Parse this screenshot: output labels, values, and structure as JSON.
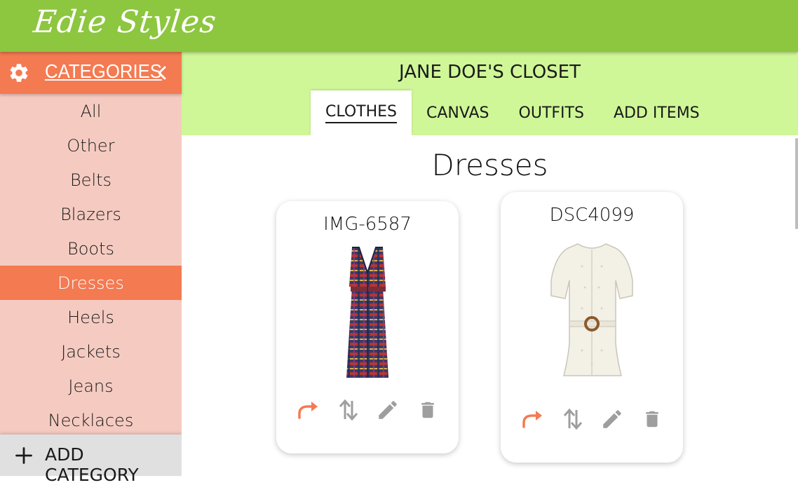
{
  "app": {
    "logo_text": "Edie Styles",
    "brand_color": "#8dc63f",
    "accent_color": "#f47a52"
  },
  "sidebar": {
    "title": "CATEGORIES",
    "header_icons": [
      "gear-icon",
      "chevron-left-icon"
    ],
    "items": [
      {
        "label": "All",
        "active": false
      },
      {
        "label": "Other",
        "active": false
      },
      {
        "label": "Belts",
        "active": false
      },
      {
        "label": "Blazers",
        "active": false
      },
      {
        "label": "Boots",
        "active": false
      },
      {
        "label": "Dresses",
        "active": true
      },
      {
        "label": "Heels",
        "active": false
      },
      {
        "label": "Jackets",
        "active": false
      },
      {
        "label": "Jeans",
        "active": false
      },
      {
        "label": "Necklaces",
        "active": false
      }
    ],
    "add_button": {
      "label": "ADD CATEGORY",
      "icon": "plus-icon"
    }
  },
  "closet": {
    "title": "JANE DOE'S CLOSET",
    "tabs": [
      {
        "label": "CLOTHES",
        "active": true
      },
      {
        "label": "CANVAS",
        "active": false
      },
      {
        "label": "OUTFITS",
        "active": false
      },
      {
        "label": "ADD ITEMS",
        "active": false
      }
    ]
  },
  "main": {
    "section_title": "Dresses",
    "items": [
      {
        "name": "IMG-6587",
        "image": "plaid-dress",
        "actions": [
          "share-icon",
          "swap-icon",
          "edit-icon",
          "delete-icon"
        ]
      },
      {
        "name": "DSC4099",
        "image": "white-eyelet-dress",
        "actions": [
          "share-icon",
          "swap-icon",
          "edit-icon",
          "delete-icon"
        ]
      }
    ]
  }
}
